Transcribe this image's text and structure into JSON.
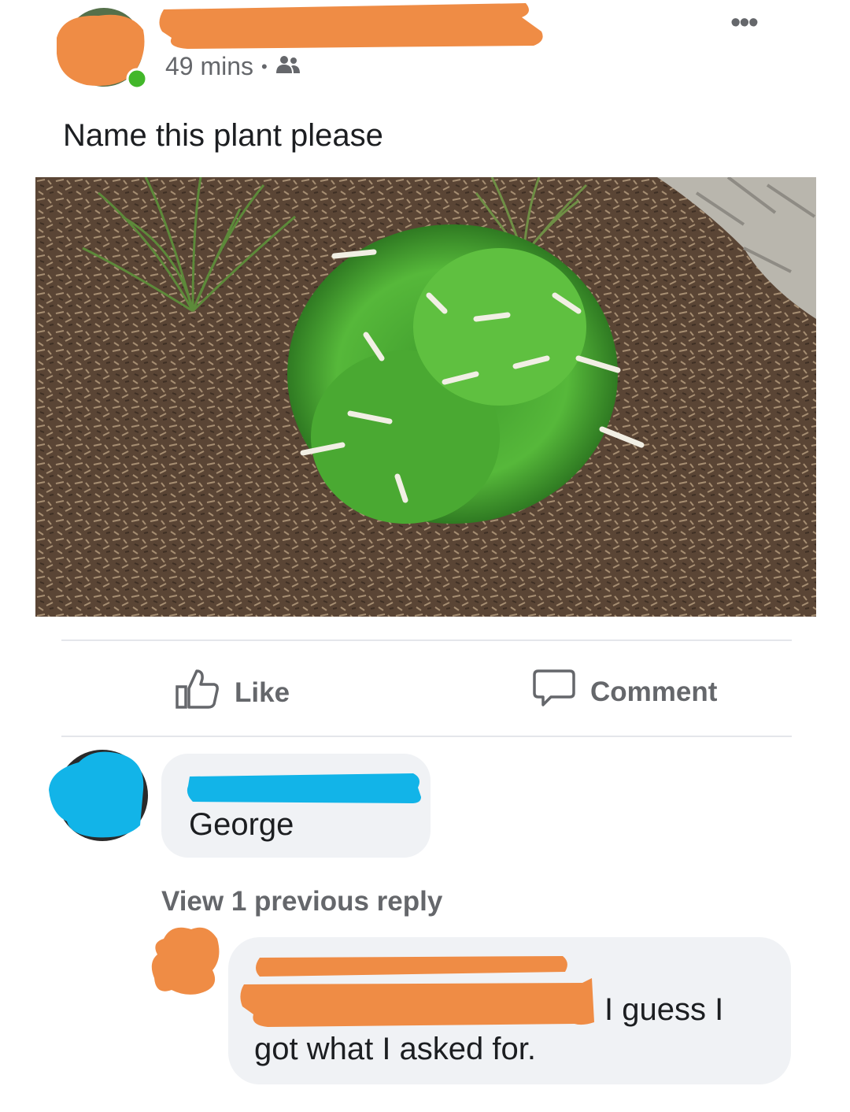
{
  "post": {
    "time": "49 mins",
    "separator": "•",
    "audience_icon": "friends-icon",
    "more_icon": "more-options-icon",
    "text": "Name this plant please",
    "photo_subject": "plant-photo"
  },
  "actions": {
    "like_label": "Like",
    "comment_label": "Comment"
  },
  "comments": [
    {
      "text": "George"
    }
  ],
  "view_replies_label": "View 1 previous reply",
  "reply": {
    "text_line1": "I guess I",
    "text_line2": "got what I asked for."
  },
  "colors": {
    "redaction_orange": "#ef8c45",
    "redaction_blue": "#12b4e8",
    "bubble_bg": "#f0f2f5",
    "meta_gray": "#65676b",
    "online_green": "#42b72a"
  }
}
